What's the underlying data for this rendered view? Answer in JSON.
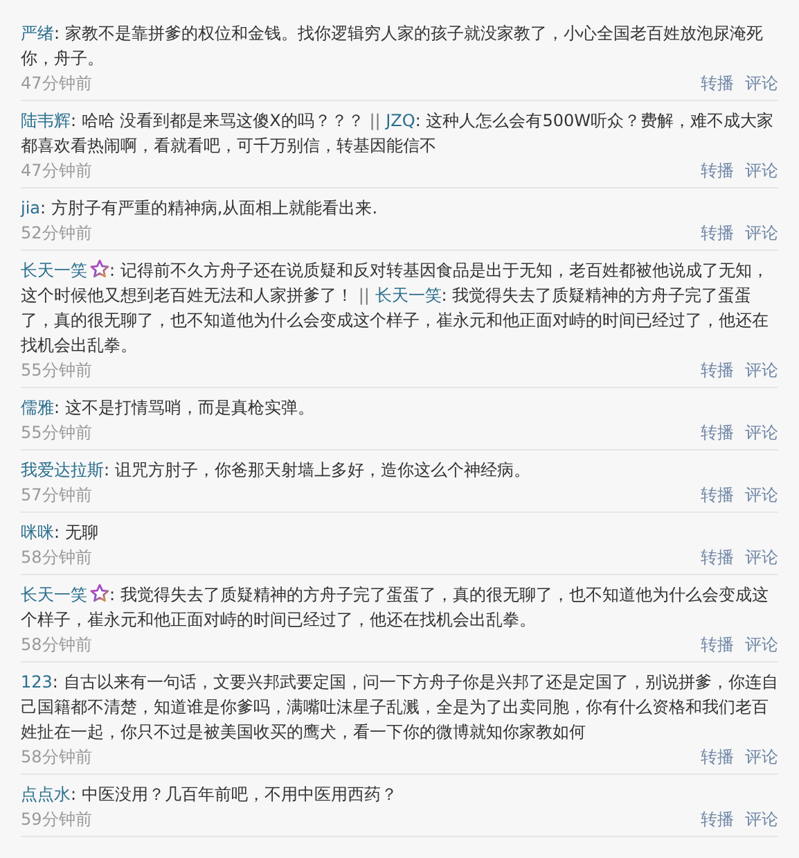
{
  "comments": [
    {
      "parts": [
        {
          "author": "严绪",
          "vip": false,
          "text": ": 家教不是靠拼爹的权位和金钱。找你逻辑穷人家的孩子就没家教了，小心全国老百姓放泡尿淹死你，舟子。"
        }
      ],
      "time": "47分钟前",
      "actions": [
        "转播",
        "评论"
      ]
    },
    {
      "separator": "||",
      "parts": [
        {
          "author": "陆韦辉",
          "vip": false,
          "text": ": 哈哈 没看到都是来骂这傻X的吗？？？ "
        },
        {
          "author": "JZQ",
          "vip": false,
          "text": ": 这种人怎么会有500W听众？费解，难不成大家都喜欢看热闹啊，看就看吧，可千万别信，转基因能信不"
        }
      ],
      "time": "47分钟前",
      "actions": [
        "转播",
        "评论"
      ]
    },
    {
      "parts": [
        {
          "author": "jia",
          "vip": false,
          "text": ": 方肘子有严重的精神病,从面相上就能看出来."
        }
      ],
      "time": "52分钟前",
      "actions": [
        "转播",
        "评论"
      ]
    },
    {
      "separator": "||",
      "parts": [
        {
          "author": "长天一笑",
          "vip": true,
          "text": ": 记得前不久方舟子还在说质疑和反对转基因食品是出于无知，老百姓都被他说成了无知，这个时候他又想到老百姓无法和人家拼爹了！ "
        },
        {
          "author": "长天一笑",
          "vip": false,
          "text": ": 我觉得失去了质疑精神的方舟子完了蛋蛋了，真的很无聊了，也不知道他为什么会变成这个样子，崔永元和他正面对峙的时间已经过了，他还在找机会出乱拳。"
        }
      ],
      "time": "55分钟前",
      "actions": [
        "转播",
        "评论"
      ]
    },
    {
      "parts": [
        {
          "author": "儒雅",
          "vip": false,
          "text": ": 这不是打情骂哨，而是真枪实弹。"
        }
      ],
      "time": "55分钟前",
      "actions": [
        "转播",
        "评论"
      ]
    },
    {
      "parts": [
        {
          "author": "我爱达拉斯",
          "vip": false,
          "text": ": 诅咒方肘子，你爸那天射墙上多好，造你这么个神经病。"
        }
      ],
      "time": "57分钟前",
      "actions": [
        "转播",
        "评论"
      ]
    },
    {
      "parts": [
        {
          "author": "咪咪",
          "vip": false,
          "text": ": 无聊"
        }
      ],
      "time": "58分钟前",
      "actions": [
        "转播",
        "评论"
      ]
    },
    {
      "parts": [
        {
          "author": "长天一笑",
          "vip": true,
          "text": ": 我觉得失去了质疑精神的方舟子完了蛋蛋了，真的很无聊了，也不知道他为什么会变成这个样子，崔永元和他正面对峙的时间已经过了，他还在找机会出乱拳。"
        }
      ],
      "time": "58分钟前",
      "actions": [
        "转播",
        "评论"
      ]
    },
    {
      "parts": [
        {
          "author": "123",
          "vip": false,
          "text": ": 自古以来有一句话，文要兴邦武要定国，问一下方舟子你是兴邦了还是定国了，别说拼爹，你连自己国籍都不清楚，知道谁是你爹吗，满嘴吐沫星子乱溅，全是为了出卖同胞，你有什么资格和我们老百姓扯在一起，你只不过是被美国收买的鹰犬，看一下你的微博就知你家教如何"
        }
      ],
      "time": "58分钟前",
      "actions": [
        "转播",
        "评论"
      ]
    },
    {
      "parts": [
        {
          "author": "点点水",
          "vip": false,
          "text": ": 中医没用？几百年前吧，不用中医用西药？"
        }
      ],
      "time": "59分钟前",
      "actions": [
        "转播",
        "评论"
      ]
    }
  ]
}
